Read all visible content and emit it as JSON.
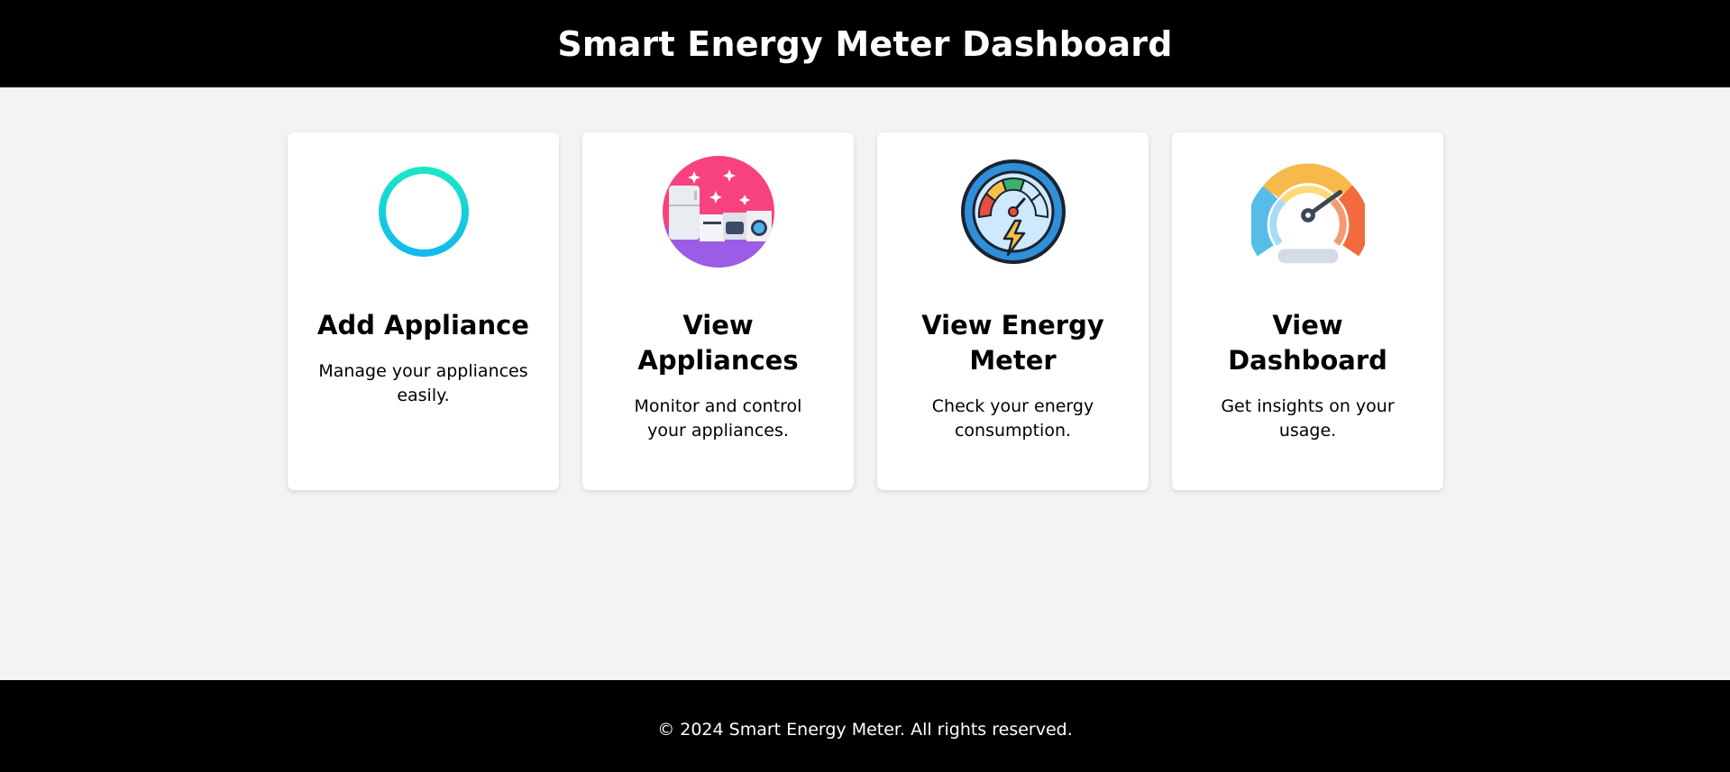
{
  "header": {
    "title": "Smart Energy Meter Dashboard"
  },
  "cards": [
    {
      "icon": "add-circle-icon",
      "title": "Add Appliance",
      "description": "Manage your appliances easily."
    },
    {
      "icon": "appliances-icon",
      "title": "View Appliances",
      "description": "Monitor and control your appliances."
    },
    {
      "icon": "energy-meter-icon",
      "title": "View Energy Meter",
      "description": "Check your energy consumption."
    },
    {
      "icon": "speedometer-icon",
      "title": "View Dashboard",
      "description": "Get insights on your usage."
    }
  ],
  "footer": {
    "text": "© 2024 Smart Energy Meter. All rights reserved."
  },
  "colors": {
    "header_bg": "#000000",
    "page_bg": "#f3f3f3",
    "card_bg": "#ffffff",
    "add_icon": "#12d6d6",
    "appliances_pink": "#f7427f",
    "appliances_purple": "#9b5de5",
    "meter_blue": "#2f8fd8",
    "gauge_orange": "#f26a3d"
  }
}
